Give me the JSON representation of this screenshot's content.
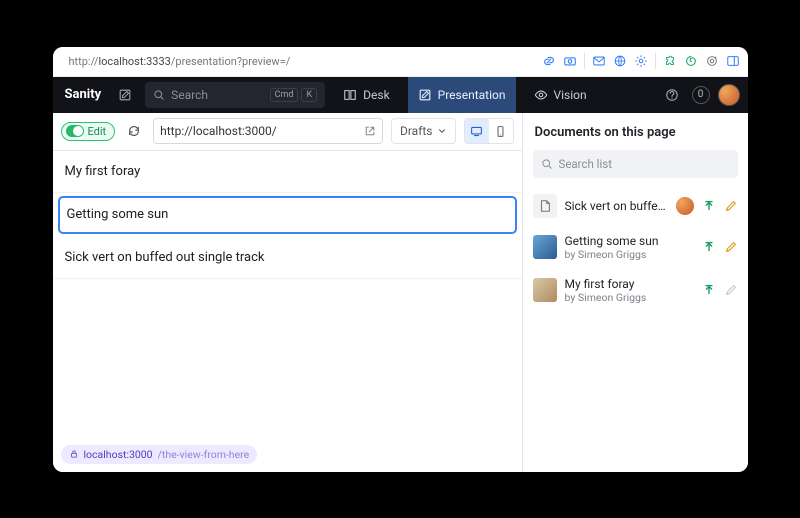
{
  "chrome": {
    "url_prefix": "http://",
    "url_host": "localhost:3333",
    "url_path": "/presentation?preview=/"
  },
  "topbar": {
    "brand": "Sanity",
    "search_placeholder": "Search",
    "kbd1": "Cmd",
    "kbd2": "K",
    "tabs": {
      "desk": "Desk",
      "presentation": "Presentation",
      "vision": "Vision"
    },
    "notif_count": "0"
  },
  "toolbar": {
    "edit_label": "Edit",
    "preview_url": "http://localhost:3000/",
    "drafts_label": "Drafts"
  },
  "preview": {
    "items": [
      {
        "title": "My first foray"
      },
      {
        "title": "Getting some sun"
      },
      {
        "title": "Sick vert on buffed out single track"
      }
    ],
    "selected_index": 1,
    "status_host": "localhost:3000",
    "status_path": "/the-view-from-here"
  },
  "docs": {
    "heading": "Documents on this page",
    "search_placeholder": "Search list",
    "items": [
      {
        "title": "Sick vert on buffed...",
        "subtitle": "",
        "has_avatar": true,
        "icon": "doc",
        "pen": "active"
      },
      {
        "title": "Getting some sun",
        "subtitle": "by Simeon Griggs",
        "has_avatar": false,
        "icon": "img1",
        "pen": "active"
      },
      {
        "title": "My first foray",
        "subtitle": "by Simeon Griggs",
        "has_avatar": false,
        "icon": "img2",
        "pen": "dim"
      }
    ]
  }
}
